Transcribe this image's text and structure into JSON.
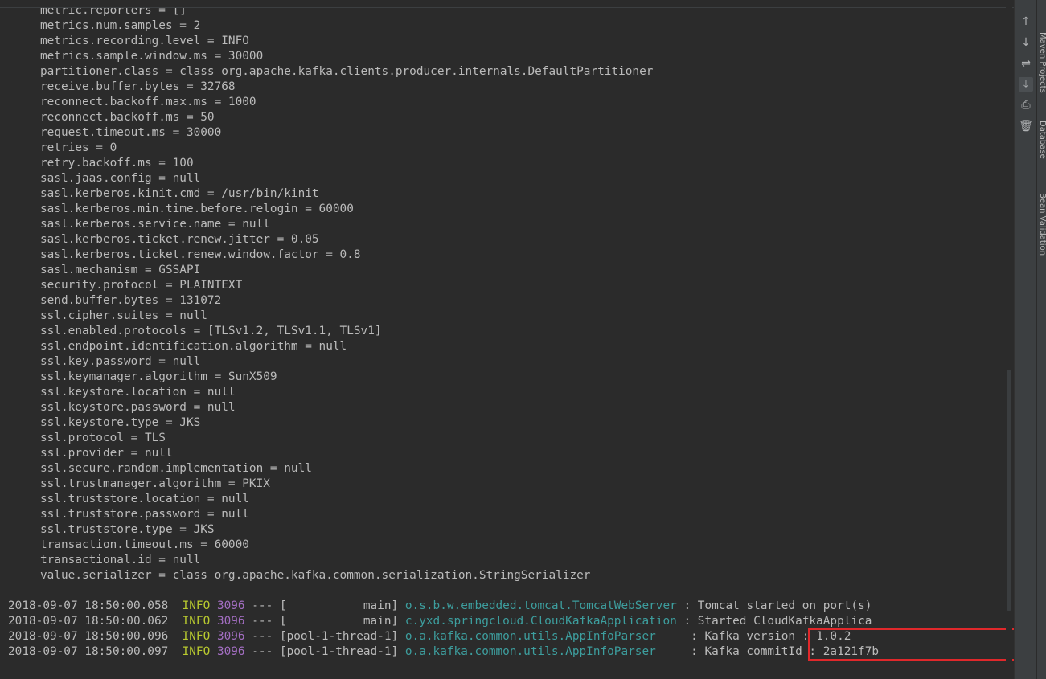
{
  "console": {
    "config_lines": [
      "metric.reporters = []",
      "metrics.num.samples = 2",
      "metrics.recording.level = INFO",
      "metrics.sample.window.ms = 30000",
      "partitioner.class = class org.apache.kafka.clients.producer.internals.DefaultPartitioner",
      "receive.buffer.bytes = 32768",
      "reconnect.backoff.max.ms = 1000",
      "reconnect.backoff.ms = 50",
      "request.timeout.ms = 30000",
      "retries = 0",
      "retry.backoff.ms = 100",
      "sasl.jaas.config = null",
      "sasl.kerberos.kinit.cmd = /usr/bin/kinit",
      "sasl.kerberos.min.time.before.relogin = 60000",
      "sasl.kerberos.service.name = null",
      "sasl.kerberos.ticket.renew.jitter = 0.05",
      "sasl.kerberos.ticket.renew.window.factor = 0.8",
      "sasl.mechanism = GSSAPI",
      "security.protocol = PLAINTEXT",
      "send.buffer.bytes = 131072",
      "ssl.cipher.suites = null",
      "ssl.enabled.protocols = [TLSv1.2, TLSv1.1, TLSv1]",
      "ssl.endpoint.identification.algorithm = null",
      "ssl.key.password = null",
      "ssl.keymanager.algorithm = SunX509",
      "ssl.keystore.location = null",
      "ssl.keystore.password = null",
      "ssl.keystore.type = JKS",
      "ssl.protocol = TLS",
      "ssl.provider = null",
      "ssl.secure.random.implementation = null",
      "ssl.trustmanager.algorithm = PKIX",
      "ssl.truststore.location = null",
      "ssl.truststore.password = null",
      "ssl.truststore.type = JKS",
      "transaction.timeout.ms = 60000",
      "transactional.id = null",
      "value.serializer = class org.apache.kafka.common.serialization.StringSerializer"
    ],
    "log_lines": [
      {
        "timestamp": "2018-09-07 18:50:00.058",
        "level": "INFO",
        "pid": "3096",
        "sep": " --- ",
        "thread": "[           main]",
        "logger": "o.s.b.w.embedded.tomcat.TomcatWebServer",
        "colon": " : ",
        "message": "Tomcat started on port(s)"
      },
      {
        "timestamp": "2018-09-07 18:50:00.062",
        "level": "INFO",
        "pid": "3096",
        "sep": " --- ",
        "thread": "[           main]",
        "logger": "c.yxd.springcloud.CloudKafkaApplication",
        "colon": " : ",
        "message": "Started CloudKafkaApplica"
      },
      {
        "timestamp": "2018-09-07 18:50:00.096",
        "level": "INFO",
        "pid": "3096",
        "sep": " --- ",
        "thread": "[pool-1-thread-1]",
        "logger": "o.a.kafka.common.utils.AppInfoParser    ",
        "colon": " : ",
        "message": "Kafka version : 1.0.2"
      },
      {
        "timestamp": "2018-09-07 18:50:00.097",
        "level": "INFO",
        "pid": "3096",
        "sep": " --- ",
        "thread": "[pool-1-thread-1]",
        "logger": "o.a.kafka.common.utils.AppInfoParser    ",
        "colon": " : ",
        "message": "Kafka commitId : 2a121f7b"
      }
    ]
  },
  "side_tabs": [
    {
      "label": "Maven Projects",
      "icon": "maven-icon"
    },
    {
      "label": "Database",
      "icon": "database-icon"
    },
    {
      "label": "Bean Validation",
      "icon": "bean-validation-icon"
    }
  ],
  "tools": [
    {
      "name": "scroll-up-icon",
      "glyph": "↑"
    },
    {
      "name": "scroll-down-icon",
      "glyph": "↓"
    },
    {
      "name": "soft-wrap-icon",
      "glyph": "⇌"
    },
    {
      "name": "scroll-to-end-icon",
      "glyph": "⤓"
    },
    {
      "name": "print-icon",
      "glyph": "⎙"
    },
    {
      "name": "clear-all-icon",
      "glyph": "🗑"
    }
  ],
  "colors": {
    "background": "#2b2b2b",
    "text": "#bbbbbb",
    "info_level": "#b8c92f",
    "pid": "#a36ec2",
    "logger": "#3d9e9e",
    "highlight_box": "#e0282b"
  }
}
